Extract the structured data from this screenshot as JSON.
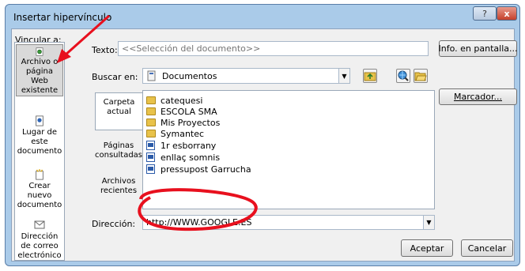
{
  "window": {
    "title": "Insertar hipervínculo",
    "help_symbol": "?",
    "close_symbol": "x"
  },
  "link_to": {
    "label": "Vincular a:",
    "items": [
      {
        "label": "Archivo o página Web existente",
        "icon": "web-page-icon",
        "selected": true
      },
      {
        "label": "Lugar de este documento",
        "icon": "bookmark-page-icon",
        "selected": false
      },
      {
        "label": "Crear nuevo documento",
        "icon": "new-document-icon",
        "selected": false
      },
      {
        "label": "Dirección de correo electrónico",
        "icon": "email-icon",
        "selected": false
      }
    ]
  },
  "text_field": {
    "label": "Texto:",
    "placeholder": "<<Selección del documento>>"
  },
  "screen_tip_button": "Info. en pantalla...",
  "look_in": {
    "label": "Buscar en:",
    "value": "Documentos"
  },
  "bookmark_button": "Marcador...",
  "subtabs": [
    {
      "label": "Carpeta actual",
      "selected": true
    },
    {
      "label": "Páginas consultadas",
      "selected": false
    },
    {
      "label": "Archivos recientes",
      "selected": false
    }
  ],
  "files": [
    {
      "name": "catequesi",
      "type": "folder"
    },
    {
      "name": "ESCOLA SMA",
      "type": "folder"
    },
    {
      "name": "Mis Proyectos",
      "type": "folder"
    },
    {
      "name": "Symantec",
      "type": "folder"
    },
    {
      "name": "1r esborrany",
      "type": "doc"
    },
    {
      "name": "enllaç somnis",
      "type": "doc"
    },
    {
      "name": "pressupost Garrucha",
      "type": "doc"
    }
  ],
  "address": {
    "label": "Dirección:",
    "value": "http://WWW.GOOGLE.ES"
  },
  "ok_button": "Aceptar",
  "cancel_button": "Cancelar",
  "colors": {
    "annotation_red": "#e8101e",
    "dialog_frame": "#aacbe9",
    "client_background": "#f0f0f0"
  }
}
